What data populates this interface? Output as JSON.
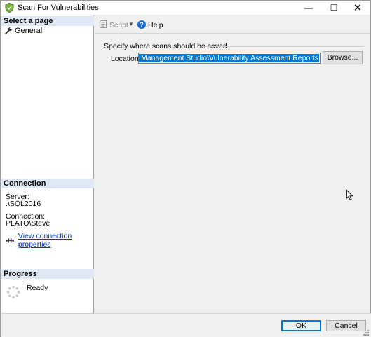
{
  "window": {
    "title": "Scan For Vulnerabilities",
    "minimize_glyph": "—",
    "maximize_glyph": "☐",
    "close_glyph": "✕"
  },
  "left_pane": {
    "select_page_header": "Select a page",
    "pages": [
      {
        "label": "General",
        "icon": "wrench-icon"
      }
    ],
    "connection_header": "Connection",
    "server_label": "Server:",
    "server_value": ".\\SQL2016",
    "connection_label": "Connection:",
    "connection_value": "PLATO\\Steve",
    "view_connection_link": "View connection properties",
    "progress_header": "Progress",
    "progress_status": "Ready"
  },
  "toolbar": {
    "script_label": "Script",
    "help_label": "Help"
  },
  "form": {
    "group_label": "Specify where scans should be saved",
    "location_label": "Location:",
    "location_value": "nts\\SQL Server Management Studio\\Vulnerability Assessment Reports",
    "browse_label": "Browse..."
  },
  "footer": {
    "ok_label": "OK",
    "cancel_label": "Cancel"
  },
  "colors": {
    "accent": "#0078d7",
    "link": "#0033cc",
    "section_header_bg": "#dfe9f5"
  }
}
